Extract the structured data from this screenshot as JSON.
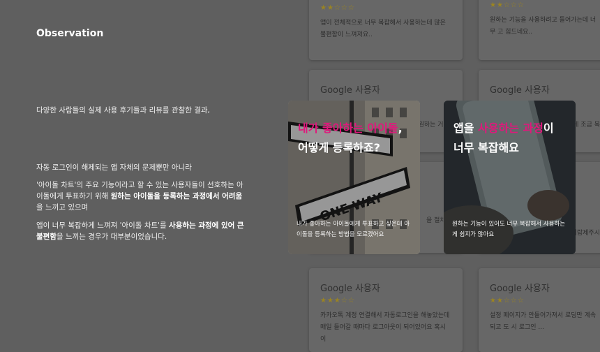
{
  "left": {
    "title": "Observation",
    "p1": "다양한 사람들의 실제 사용 후기들과 리뷰를 관찰한 결과,",
    "p2": "자동 로그인이 해제되는 앱 자체의 문제뿐만 아니라",
    "p3_a": "'아이돌 차트'의 주요 기능이라고 할 수 있는 사용자들이 선호하는 아이돌에게 투표하기 위해 ",
    "p3_b": "원하는 아이돌을 등록하는 과정에서 어려움",
    "p3_c": "을 느끼고 있으며",
    "p4_a": "앱이 너무 복잡하게 느껴져 '아이돌 차트'를 ",
    "p4_b": "사용하는 과정에 있어 큰 불편함",
    "p4_c": "을 느끼는 경우가 대부분이었습니다."
  },
  "reviews": {
    "r1": {
      "stars": "★★☆☆☆",
      "body": "앱이 전체적으로 너무 복잡해서 사용하는데 많은 불편함이 느껴져요.."
    },
    "r2": {
      "stars": "★★☆☆☆",
      "body": "원하는 기능을 사용하려고 들어가는데 너무 고 힘드네요.."
    },
    "r3": {
      "name": "Google 사용자",
      "body": "원하는 거 ..."
    },
    "r4": {
      "name": "Google 사용자",
      "body": "게 조금 복"
    },
    "r5": {
      "body": "을 절차가"
    },
    "r6": {
      "body": "이랍제주시"
    },
    "r7": {
      "name": "Google 사용자",
      "stars": "★★★☆☆",
      "body": "카카오톡 계정 연결해서 자동로그인을 해놓았는데 매일 들어갈 때마다 로그아웃이 되어있어요 혹시 이"
    },
    "r8": {
      "name": "Google 사용자",
      "stars": "★★☆☆☆",
      "body": "설정 페이지가 안들어가져서 로딩만 계속 되고 도 시 로그인 ..."
    }
  },
  "features": {
    "f1": {
      "headline_pink": "내가 좋아하는 아이돌",
      "headline_rest1": ",",
      "headline_rest2": "어떻게 등록하죠?",
      "caption": "내가 좋아하는 아이돌에게 투표하고 싶은데 아이돌을 등록하는 방법을 모르겠어요"
    },
    "f2": {
      "headline_a": "앱을 ",
      "headline_pink": "사용하는 과정",
      "headline_b": "이",
      "headline_line2": "너무 복잡해요",
      "caption": "원하는 기능이 있어도 너무 복잡해서 사용하는게 쉽지가 않아요"
    }
  },
  "colors": {
    "accent": "#e0187c",
    "background": "#5f5f5f"
  }
}
